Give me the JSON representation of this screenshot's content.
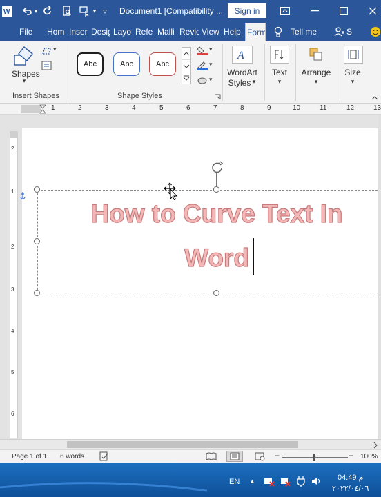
{
  "titlebar": {
    "doc_title": "Document1 [Compatibility ...",
    "signin_label": "Sign in"
  },
  "tabs": [
    {
      "label": "File"
    },
    {
      "label": "Hom"
    },
    {
      "label": "Inser"
    },
    {
      "label": "Desig"
    },
    {
      "label": "Layo"
    },
    {
      "label": "Refe"
    },
    {
      "label": "Maili"
    },
    {
      "label": "Revie"
    },
    {
      "label": "View"
    },
    {
      "label": "Help"
    },
    {
      "label": "Form"
    },
    {
      "label": "Tell me"
    },
    {
      "label": "S"
    }
  ],
  "ribbon": {
    "shapes_label": "Shapes",
    "insert_shapes_label": "Insert Shapes",
    "shape_styles_label": "Shape Styles",
    "style_thumbs": [
      {
        "label": "Abc",
        "border_color": "#1f1f1f"
      },
      {
        "label": "Abc",
        "border_color": "#4472c4"
      },
      {
        "label": "Abc",
        "border_color": "#c0504d"
      }
    ],
    "wordart_label_1": "WordArt",
    "wordart_label_2": "Styles",
    "text_label": "Text",
    "arrange_label": "Arrange",
    "size_label": "Size"
  },
  "ruler": {
    "numbers": [
      "1",
      "2",
      "3",
      "4",
      "5",
      "6",
      "7",
      "8",
      "9",
      "10",
      "11",
      "12",
      "13"
    ]
  },
  "document": {
    "wordart_line1": "How to Curve Text In",
    "wordart_line2": "Word",
    "wordart_fill": "#f2b8b8",
    "wordart_outline": "#c97b7b"
  },
  "statusbar": {
    "page_info": "Page 1 of 1",
    "word_count": "6 words",
    "zoom": "100%"
  },
  "taskbar": {
    "language": "EN",
    "time": "04:49 م",
    "date": "٢٠٢٢/٠٤/٠٦"
  },
  "colors": {
    "accent": "#2b579a",
    "ribbon_bg": "#f3f3f3"
  }
}
